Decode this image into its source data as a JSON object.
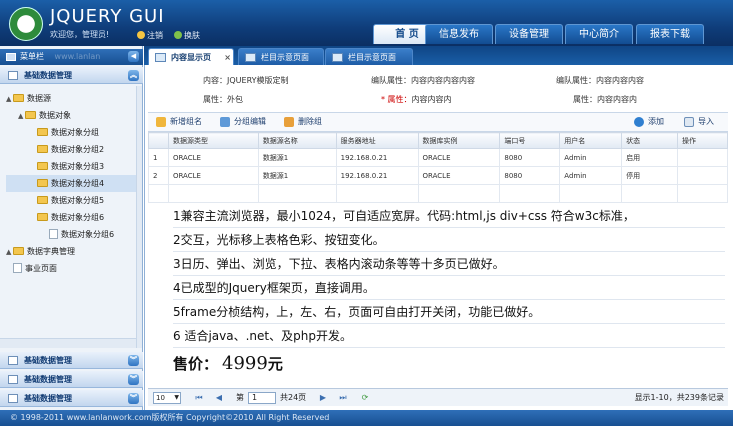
{
  "header": {
    "title": "JQUERY GUI",
    "welcome": "欢迎您，管理员!",
    "logout": "注销",
    "switch_skin": "换肤",
    "nav": [
      "首 页",
      "信息发布",
      "设备管理",
      "中心简介",
      "报表下载"
    ]
  },
  "sidebar": {
    "title": "菜单栏",
    "watermark": "www.lanlan",
    "top_panel": "基础数据管理",
    "tree": [
      {
        "label": "数据源",
        "type": "folder",
        "level": 0,
        "toggle": "▲"
      },
      {
        "label": "数据对象",
        "type": "folder",
        "level": 1,
        "toggle": "▲"
      },
      {
        "label": "数据对象分组",
        "type": "folder",
        "level": 2
      },
      {
        "label": "数据对象分组2",
        "type": "folder",
        "level": 2
      },
      {
        "label": "数据对象分组3",
        "type": "folder",
        "level": 2
      },
      {
        "label": "数据对象分组4",
        "type": "folder",
        "level": 2
      },
      {
        "label": "数据对象分组5",
        "type": "folder",
        "level": 2
      },
      {
        "label": "数据对象分组6",
        "type": "folder",
        "level": 2
      },
      {
        "label": "数据对象分组6",
        "type": "page",
        "level": 3
      },
      {
        "label": "数据字典管理",
        "type": "folder",
        "level": 0,
        "toggle": "▲"
      },
      {
        "label": "事业页面",
        "type": "page",
        "level": 0
      }
    ],
    "bottom_panels": [
      "基础数据管理",
      "基础数据管理",
      "基础数据管理"
    ]
  },
  "tabs": [
    {
      "label": "内容显示页",
      "active": true
    },
    {
      "label": "栏目示意页面",
      "active": false
    },
    {
      "label": "栏目示意页面",
      "active": false
    }
  ],
  "form": {
    "row1": [
      {
        "label": "内容：",
        "value": "JQUERY模版定制"
      },
      {
        "label": "编队属性：",
        "value": "内容内容内容内容"
      },
      {
        "label": "编队属性：",
        "value": "内容内容内容"
      }
    ],
    "row2": [
      {
        "label": "属性：",
        "value": "外包"
      },
      {
        "label": "* 属性：",
        "value": "内容内容内"
      },
      {
        "label": "属性：",
        "value": "内容内容内"
      }
    ]
  },
  "toolbar": {
    "add_group": "新增组名",
    "edit_group": "分组编辑",
    "delete_group": "删除组",
    "add": "添加",
    "import": "导入"
  },
  "table": {
    "columns": [
      "",
      "数据源类型",
      "数据源名称",
      "服务器地址",
      "数据库实例",
      "端口号",
      "用户名",
      "状态",
      "操作"
    ],
    "rows": [
      [
        "1",
        "ORACLE",
        "数据源1",
        "192.168.0.21",
        "ORACLE",
        "8080",
        "Admin",
        "启用",
        ""
      ],
      [
        "2",
        "ORACLE",
        "数据源1",
        "192.168.0.21",
        "ORACLE",
        "8080",
        "Admin",
        "停用",
        ""
      ]
    ]
  },
  "info_lines": [
    "1兼容主流浏览器，最小1024，可自适应宽屏。代码:html,js div+css 符合w3c标准，",
    "2交互，光标移上表格色彩、按钮变化。",
    "3日历、弹出、浏览，下拉、表格内滚动条等等十多页已做好。",
    "4已成型的Jquery框架页，直接调用。",
    "5frame分桢结构，上，左、右，页面可自由打开关闭，功能已做好。",
    "6 适合java、.net、及php开发。"
  ],
  "price": {
    "label": "售价：",
    "value": "4999",
    "unit": "元"
  },
  "pager": {
    "page_size": "10",
    "page_prefix": "第",
    "page_value": "1",
    "page_total": "共24页",
    "summary": "显示1-10，共239条记录"
  },
  "footer": "© 1998-2011 www.lanlanwork.com版权所有  Copyright©2010 All Right Reserved"
}
